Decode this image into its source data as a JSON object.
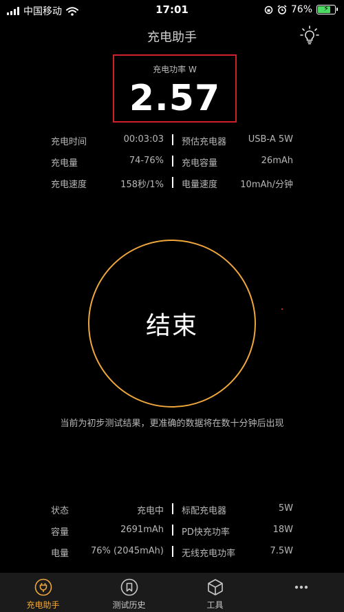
{
  "status_bar": {
    "carrier": "中国移动",
    "time": "17:01",
    "battery_percent": "76%",
    "battery_level": 0.76,
    "icons": [
      "signal-icon",
      "wifi-icon",
      "rotation-lock-icon",
      "alarm-icon",
      "battery-charging-icon"
    ]
  },
  "header": {
    "title": "充电助手",
    "light_icon": "lightbulb-icon"
  },
  "power": {
    "label": "充电功率 W",
    "value": "2.57"
  },
  "stats": [
    {
      "label1": "充电时间",
      "value1": "00:03:03",
      "label2": "预估充电器",
      "value2": "USB-A 5W"
    },
    {
      "label1": "充电量",
      "value1": "74-76%",
      "label2": "充电容量",
      "value2": "26mAh"
    },
    {
      "label1": "充电速度",
      "value1": "158秒/1%",
      "label2": "电量速度",
      "value2": "10mAh/分钟"
    }
  ],
  "main": {
    "end_button": "结束",
    "note": "当前为初步测试结果，更准确的数据将在数十分钟后出现"
  },
  "info": [
    {
      "label1": "状态",
      "value1": "充电中",
      "label2": "标配充电器",
      "value2": "5W"
    },
    {
      "label1": "容量",
      "value1": "2691mAh",
      "label2": "PD快充功率",
      "value2": "18W"
    },
    {
      "label1": "电量",
      "value1": "76% (2045mAh)",
      "label2": "无线充电功率",
      "value2": "7.5W"
    }
  ],
  "tabs": [
    {
      "label": "充电助手",
      "icon": "plug-icon",
      "active": true
    },
    {
      "label": "测试历史",
      "icon": "bookmark-icon",
      "active": false
    },
    {
      "label": "工具",
      "icon": "cube-icon",
      "active": false
    },
    {
      "label": "",
      "icon": "more-icon",
      "active": false
    }
  ],
  "colors": {
    "accent": "#f0a83c",
    "highlight_border": "#d0202a",
    "background": "#000000",
    "tab_bar": "#1b1b1b",
    "battery_fill": "#4cd964"
  }
}
